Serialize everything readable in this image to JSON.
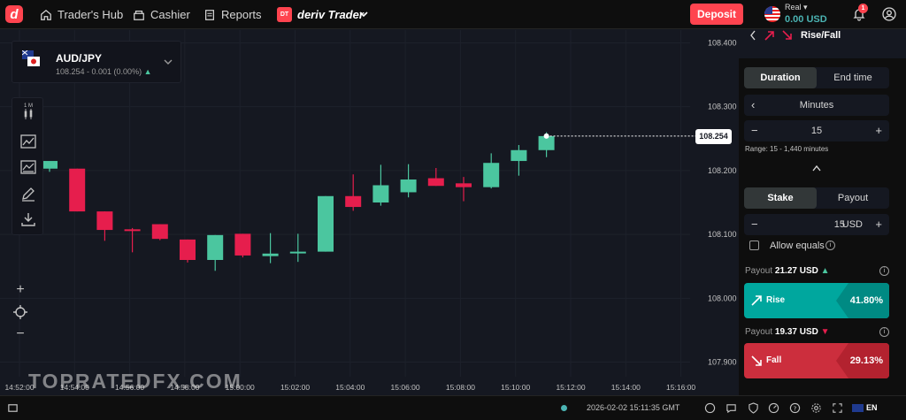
{
  "header": {
    "nav": [
      {
        "label": "Trader's Hub",
        "icon": "home-icon"
      },
      {
        "label": "Cashier",
        "icon": "cashier-icon"
      },
      {
        "label": "Reports",
        "icon": "reports-icon"
      }
    ],
    "platform_badge": "DT",
    "platform_label": "deriv Trader",
    "deposit_label": "Deposit",
    "account_type": "Real",
    "account_balance": "0.00 USD",
    "notification_count": "1"
  },
  "chart": {
    "symbol": "AUD/JPY",
    "symbol_quote": "108.254 - 0.001 (0.00%)",
    "interval": "1 M",
    "current_price_label": "108.254",
    "watermark": "TOPRATEDFX.COM",
    "colors": {
      "up": "#4bc69f",
      "down": "#e61e4d"
    }
  },
  "chart_data": {
    "type": "candlestick",
    "x_ticks": [
      "14:52:00",
      "14:54:00",
      "14:56:00",
      "14:58:00",
      "15:00:00",
      "15:02:00",
      "15:04:00",
      "15:06:00",
      "15:08:00",
      "15:10:00",
      "15:12:00",
      "15:14:00",
      "15:16:00"
    ],
    "y_ticks": [
      "108.400",
      "108.300",
      "108.200",
      "108.100",
      "108.000",
      "107.900"
    ],
    "ylim": [
      107.88,
      108.42
    ],
    "current_price": 108.254,
    "candles": [
      {
        "o": 108.203,
        "h": 108.213,
        "l": 108.198,
        "c": 108.215
      },
      {
        "o": 108.203,
        "h": 108.203,
        "l": 108.136,
        "c": 108.136
      },
      {
        "o": 108.136,
        "h": 108.136,
        "l": 108.09,
        "c": 108.107
      },
      {
        "o": 108.108,
        "h": 108.11,
        "l": 108.072,
        "c": 108.106
      },
      {
        "o": 108.116,
        "h": 108.116,
        "l": 108.091,
        "c": 108.093
      },
      {
        "o": 108.092,
        "h": 108.092,
        "l": 108.056,
        "c": 108.06
      },
      {
        "o": 108.06,
        "h": 108.099,
        "l": 108.043,
        "c": 108.099
      },
      {
        "o": 108.101,
        "h": 108.101,
        "l": 108.064,
        "c": 108.067
      },
      {
        "o": 108.066,
        "h": 108.102,
        "l": 108.055,
        "c": 108.07
      },
      {
        "o": 108.071,
        "h": 108.101,
        "l": 108.057,
        "c": 108.073
      },
      {
        "o": 108.073,
        "h": 108.16,
        "l": 108.073,
        "c": 108.16
      },
      {
        "o": 108.16,
        "h": 108.194,
        "l": 108.137,
        "c": 108.143
      },
      {
        "o": 108.15,
        "h": 108.209,
        "l": 108.145,
        "c": 108.177
      },
      {
        "o": 108.166,
        "h": 108.21,
        "l": 108.158,
        "c": 108.186
      },
      {
        "o": 108.188,
        "h": 108.204,
        "l": 108.176,
        "c": 108.176
      },
      {
        "o": 108.18,
        "h": 108.19,
        "l": 108.152,
        "c": 108.174
      },
      {
        "o": 108.174,
        "h": 108.227,
        "l": 108.172,
        "c": 108.212
      },
      {
        "o": 108.215,
        "h": 108.24,
        "l": 108.192,
        "c": 108.232
      },
      {
        "o": 108.232,
        "h": 108.26,
        "l": 108.221,
        "c": 108.254
      }
    ]
  },
  "trade": {
    "trade_type": "Rise/Fall",
    "duration_tabs": [
      "Duration",
      "End time"
    ],
    "duration_unit": "Minutes",
    "duration_value": "15",
    "range_text": "Range: 15 - 1,440 minutes",
    "stake_tabs": [
      "Stake",
      "Payout"
    ],
    "stake_value": "15",
    "stake_currency": "USD",
    "allow_equals": "Allow equals",
    "rise": {
      "payout_label": "Payout",
      "payout": "21.27 USD",
      "label": "Rise",
      "percent": "41.80%",
      "color": "#00a79e"
    },
    "fall": {
      "payout_label": "Payout",
      "payout": "19.37 USD",
      "label": "Fall",
      "percent": "29.13%",
      "color": "#cc2e3d"
    }
  },
  "footer": {
    "datetime": "2026-02-02 15:11:35 GMT",
    "language": "EN"
  }
}
